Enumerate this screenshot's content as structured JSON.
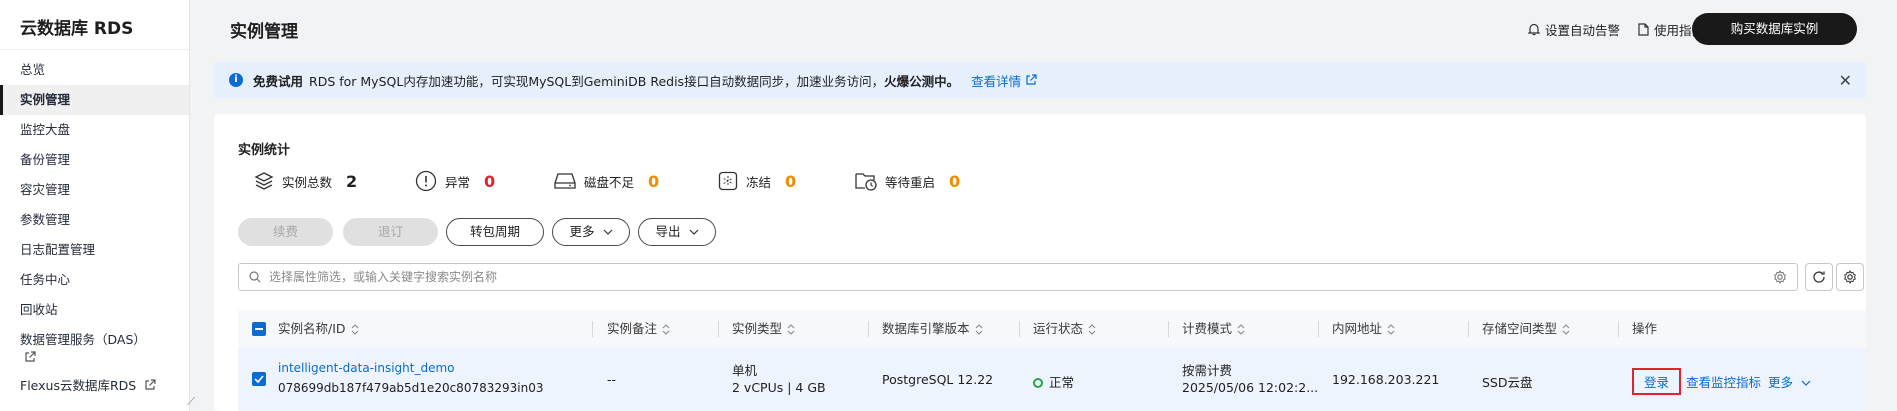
{
  "sidebar": {
    "title": "云数据库 RDS",
    "items": [
      {
        "label": "总览"
      },
      {
        "label": "实例管理"
      },
      {
        "label": "监控大盘"
      },
      {
        "label": "备份管理"
      },
      {
        "label": "容灾管理"
      },
      {
        "label": "参数管理"
      },
      {
        "label": "日志配置管理"
      },
      {
        "label": "任务中心"
      },
      {
        "label": "回收站"
      },
      {
        "label": "数据管理服务（DAS）"
      },
      {
        "label": "Flexus云数据库RDS"
      }
    ],
    "active": "实例管理"
  },
  "header": {
    "title": "实例管理",
    "alarm_label": "设置自动告警",
    "guide_label": "使用指南",
    "buy_label": "购买数据库实例"
  },
  "notice": {
    "bold_prefix": "免费试用",
    "text": "RDS for MySQL内存加速功能，可实现MySQL到GeminiDB Redis接口自动数据同步，加速业务访问，",
    "bold_suffix": "火爆公测中。",
    "link": "查看详情"
  },
  "stats": {
    "title": "实例统计",
    "items": [
      {
        "label": "实例总数",
        "value": "2",
        "icon": "layers-icon"
      },
      {
        "label": "异常",
        "value": "0",
        "icon": "alert-circle-icon"
      },
      {
        "label": "磁盘不足",
        "value": "0",
        "icon": "disk-icon"
      },
      {
        "label": "冻结",
        "value": "0",
        "icon": "frozen-icon"
      },
      {
        "label": "等待重启",
        "value": "0",
        "icon": "folder-clock-icon"
      }
    ]
  },
  "toolbar": {
    "renew": "续费",
    "unsubscribe": "退订",
    "to_yearly": "转包周期",
    "more": "更多",
    "export": "导出"
  },
  "search": {
    "placeholder": "选择属性筛选，或输入关键字搜索实例名称"
  },
  "table": {
    "columns": [
      "实例名称/ID",
      "实例备注",
      "实例类型",
      "数据库引擎版本",
      "运行状态",
      "计费模式",
      "内网地址",
      "存储空间类型",
      "操作"
    ],
    "rows": [
      {
        "name": "intelligent-data-insight_demo",
        "id": "078699db187f479ab5d1e20c80783293in03",
        "remark": "--",
        "type": "单机",
        "spec": "2 vCPUs | 4 GB",
        "engine": "PostgreSQL 12.22",
        "status": "正常",
        "billing": "按需计费",
        "billing_time": "2025/05/06 12:02:2...",
        "ip": "192.168.203.221",
        "storage": "SSD云盘",
        "action_login": "登录",
        "action_monitor": "查看监控指标",
        "action_more": "更多"
      }
    ]
  },
  "colors": {
    "accent": "#0b6bd3",
    "danger": "#e0242f",
    "warning": "#f08c00",
    "success": "#2ba245",
    "primary_button": "#191919"
  }
}
